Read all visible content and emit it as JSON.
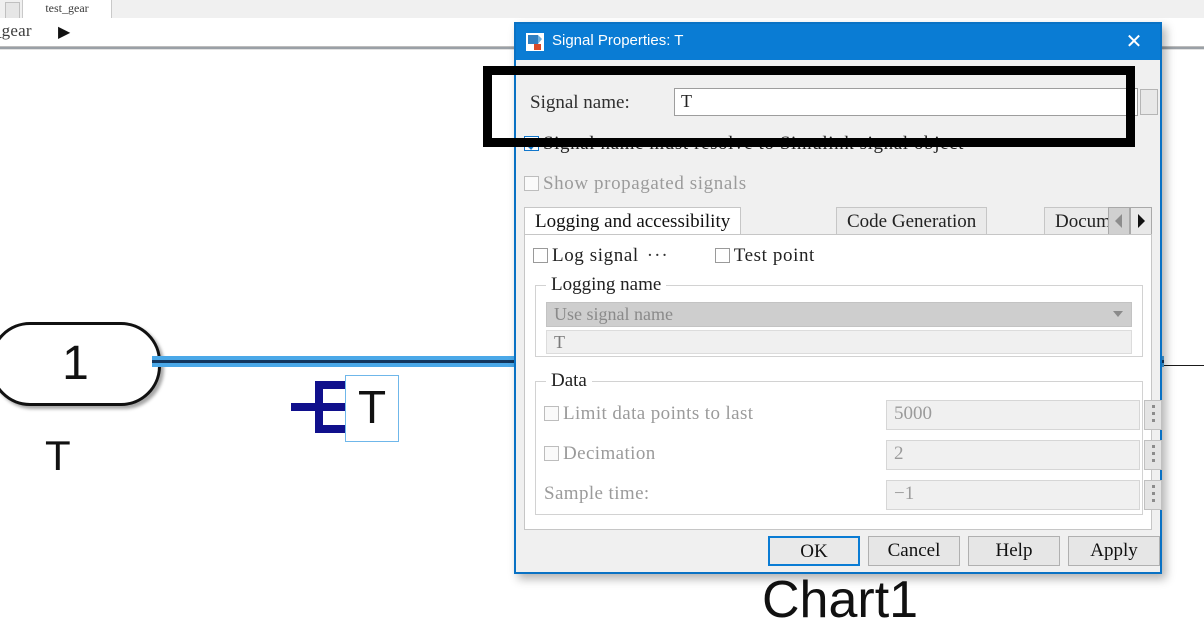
{
  "canvas": {
    "tab_label": "test_gear",
    "breadcrumb": "t_gear",
    "breadcrumb_arrow": "▶",
    "inport_number": "1",
    "inport_label": "T",
    "signal_label_box": "T",
    "chart_label": "Chart1",
    "wire_color": "#4aa8e8",
    "cursor_icon": "signal-label-cursor"
  },
  "dialog": {
    "title": "Signal Properties: T",
    "title_icon": "simulink-signal-icon",
    "close_icon": "✕",
    "titlebar_color": "#0a7cd4",
    "border_color": "#0a72c4",
    "signal_name": {
      "label": "Signal name:",
      "value": "T",
      "placeholder": "",
      "browse_icon": "browse-button"
    },
    "resolve_checkbox": {
      "label": "Signal name must resolve to Simulink signal object",
      "checked": true,
      "enabled": true
    },
    "propagated_checkbox": {
      "label": "Show propagated signals",
      "checked": false,
      "enabled": false
    },
    "tabs": [
      {
        "label": "Logging and accessibility",
        "active": true
      },
      {
        "label": "Code Generation",
        "active": false
      },
      {
        "label": "Docume",
        "active": false
      }
    ],
    "tab_scroll_left_icon": "◀",
    "tab_scroll_right_icon": "▶",
    "log_signal": {
      "label": "Log signal",
      "checked": false,
      "ellipsis": "···"
    },
    "test_point": {
      "label": "Test point",
      "checked": false
    },
    "logging_name_group": {
      "title": "Logging name",
      "mode_value": "Use signal name",
      "name_value": "T",
      "enabled": false
    },
    "data_group": {
      "title": "Data",
      "rows": [
        {
          "label": "Limit data points to last",
          "value": "5000",
          "type": "checkbox",
          "checked": false
        },
        {
          "label": "Decimation",
          "value": "2",
          "type": "checkbox",
          "checked": false
        },
        {
          "label": "Sample time:",
          "value": "−1",
          "type": "label"
        }
      ]
    },
    "buttons": [
      {
        "label": "OK",
        "focused": true
      },
      {
        "label": "Cancel",
        "focused": false
      },
      {
        "label": "Help",
        "focused": false
      },
      {
        "label": "Apply",
        "focused": false
      }
    ]
  },
  "annotation": {
    "shape": "highlight-rectangle",
    "color": "#000000"
  }
}
